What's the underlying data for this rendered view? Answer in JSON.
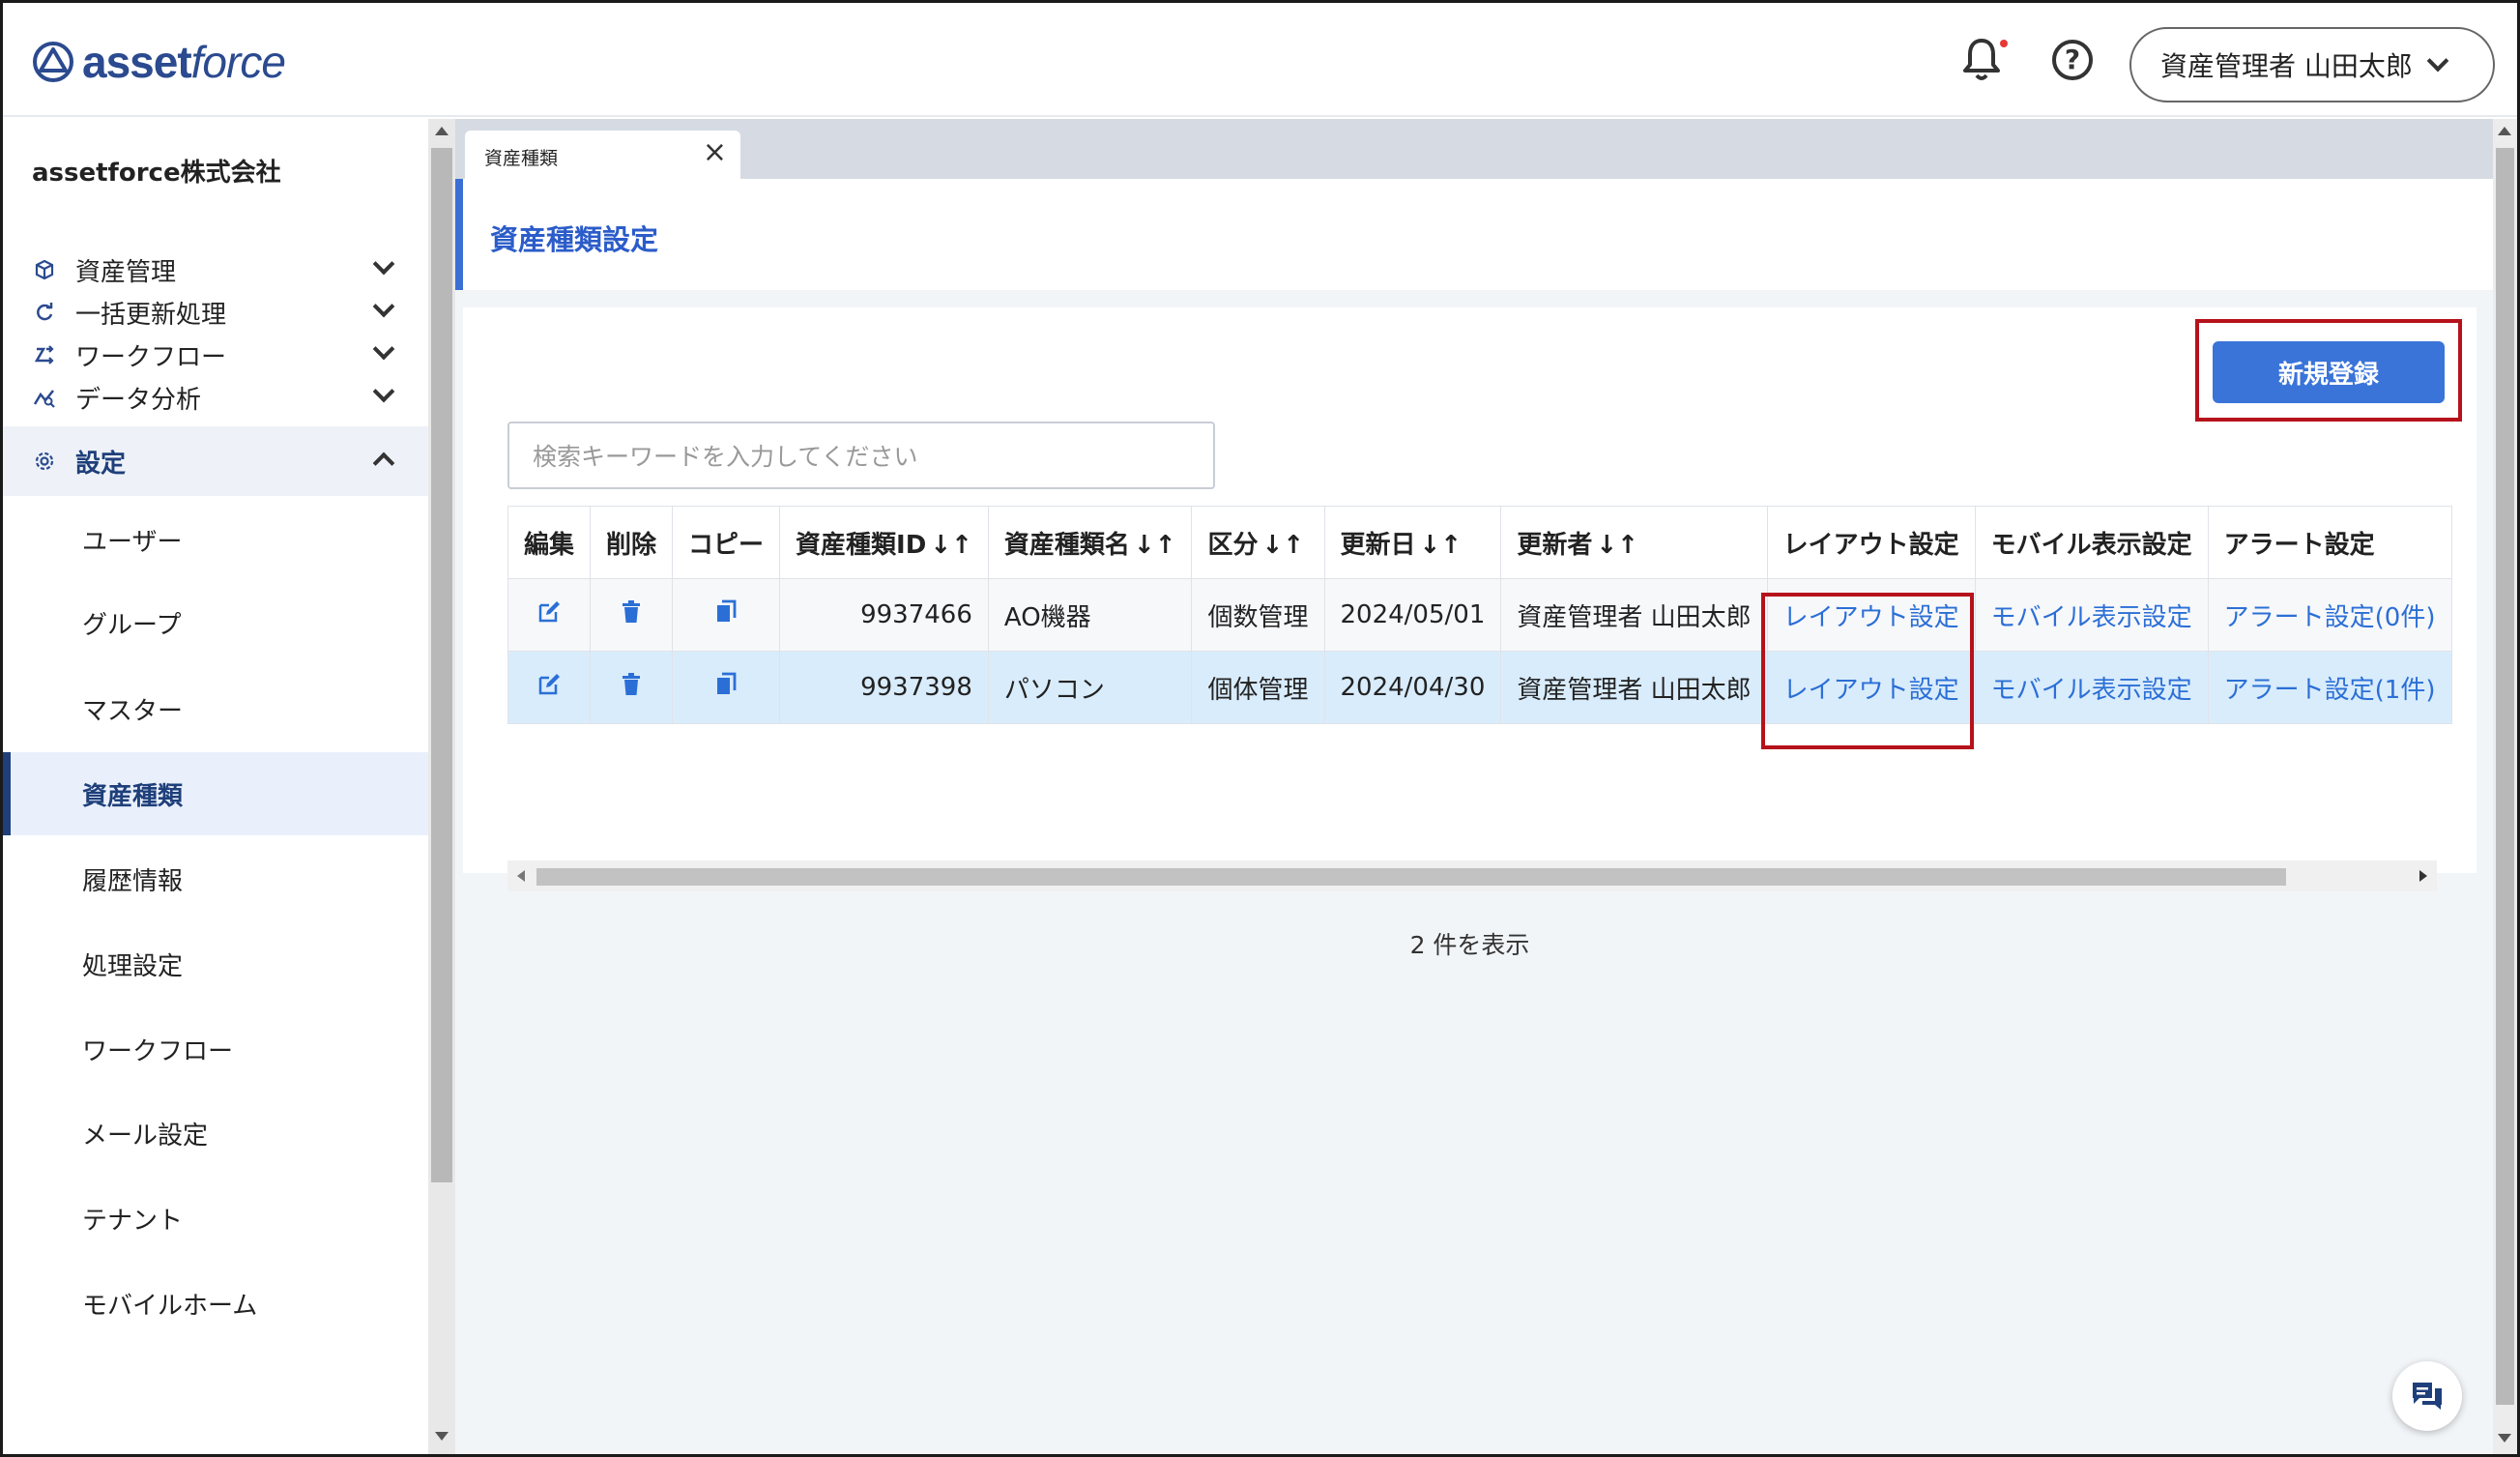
{
  "header": {
    "logo_bold": "asset",
    "logo_light": "force",
    "user_menu_label": "資産管理者 山田太郎",
    "help_glyph": "?"
  },
  "sidebar": {
    "company": "assetforce株式会社",
    "sections": [
      {
        "label": "資産管理",
        "icon": "cube-icon",
        "expanded": false
      },
      {
        "label": "一括更新処理",
        "icon": "refresh-icon",
        "expanded": false
      },
      {
        "label": "ワークフロー",
        "icon": "workflow-icon",
        "expanded": false
      },
      {
        "label": "データ分析",
        "icon": "analytics-icon",
        "expanded": false
      },
      {
        "label": "設定",
        "icon": "gear-icon",
        "expanded": true
      }
    ],
    "settings_items": [
      {
        "label": "ユーザー"
      },
      {
        "label": "グループ"
      },
      {
        "label": "マスター"
      },
      {
        "label": "資産種類",
        "active": true
      },
      {
        "label": "履歴情報"
      },
      {
        "label": "処理設定"
      },
      {
        "label": "ワークフロー"
      },
      {
        "label": "メール設定"
      },
      {
        "label": "テナント"
      },
      {
        "label": "モバイルホーム"
      }
    ]
  },
  "tab": {
    "label": "資産種類",
    "close_glyph": "×"
  },
  "page": {
    "title": "資産種類設定",
    "new_button": "新規登録",
    "search_placeholder": "検索キーワードを入力してください",
    "result_count": "2 件を表示"
  },
  "table": {
    "headers": [
      "編集",
      "削除",
      "コピー",
      "資産種類ID",
      "資産種類名",
      "区分",
      "更新日",
      "更新者",
      "レイアウト設定",
      "モバイル表示設定",
      "アラート設定"
    ],
    "sort_glyph": "↓↑",
    "rows": [
      {
        "id": "9937466",
        "name": "AO機器",
        "category": "個数管理",
        "updated": "2024/05/01",
        "updater": "資産管理者 山田太郎",
        "layout": "レイアウト設定",
        "mobile": "モバイル表示設定",
        "alert": "アラート設定(0件)"
      },
      {
        "id": "9937398",
        "name": "パソコン",
        "category": "個体管理",
        "updated": "2024/04/30",
        "updater": "資産管理者 山田太郎",
        "layout": "レイアウト設定",
        "mobile": "モバイル表示設定",
        "alert": "アラート設定(1件)"
      }
    ]
  },
  "colors": {
    "brand": "#2b4a8f",
    "accent": "#3a74d9",
    "link": "#2b6fd6",
    "highlight": "#b5121b",
    "selected_row": "#d9ecfc"
  }
}
